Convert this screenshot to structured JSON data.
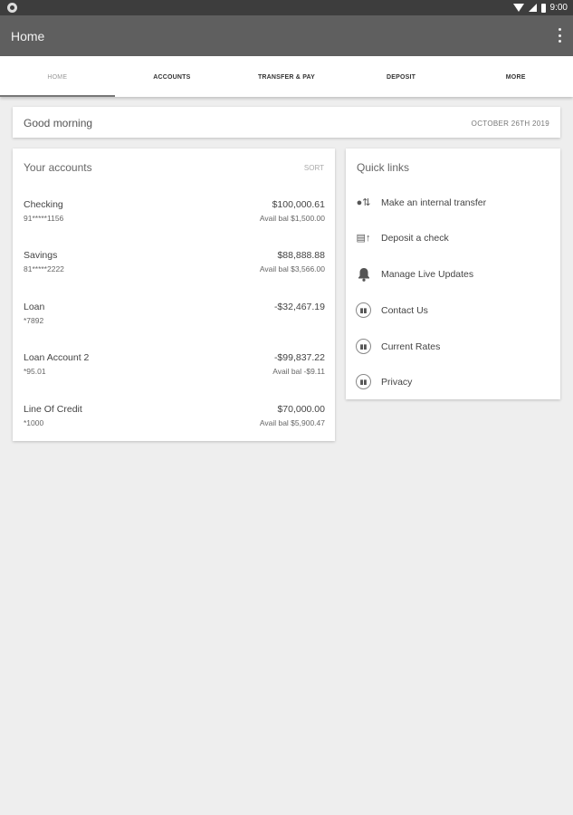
{
  "status_bar": {
    "time": "9:00"
  },
  "app_bar": {
    "title": "Home"
  },
  "tabs": [
    {
      "label": "HOME"
    },
    {
      "label": "ACCOUNTS"
    },
    {
      "label": "TRANSFER & PAY"
    },
    {
      "label": "DEPOSIT"
    },
    {
      "label": "MORE"
    }
  ],
  "greeting": {
    "message": "Good morning",
    "date": "OCTOBER 26TH 2019"
  },
  "accounts": {
    "title": "Your accounts",
    "sort_label": "SORT",
    "items": [
      {
        "name": "Checking",
        "number": "91*****1156",
        "amount": "$100,000.61",
        "available": "Avail bal $1,500.00"
      },
      {
        "name": "Savings",
        "number": "81*****2222",
        "amount": "$88,888.88",
        "available": "Avail bal $3,566.00"
      },
      {
        "name": "Loan",
        "number": "*7892",
        "amount": "-$32,467.19",
        "available": ""
      },
      {
        "name": "Loan Account 2",
        "number": "*95.01",
        "amount": "-$99,837.22",
        "available": "Avail bal -$9.11"
      },
      {
        "name": "Line Of Credit",
        "number": "*1000",
        "amount": "$70,000.00",
        "available": "Avail bal $5,900.47"
      }
    ]
  },
  "quick_links": {
    "title": "Quick links",
    "items": [
      {
        "label": "Make an internal transfer",
        "icon": "transfer-icon"
      },
      {
        "label": "Deposit a check",
        "icon": "check-deposit-icon"
      },
      {
        "label": "Manage Live Updates",
        "icon": "bell-icon"
      },
      {
        "label": "Contact Us",
        "icon": "info-link-icon"
      },
      {
        "label": "Current Rates",
        "icon": "info-link-icon"
      },
      {
        "label": "Privacy",
        "icon": "info-link-icon"
      }
    ]
  }
}
